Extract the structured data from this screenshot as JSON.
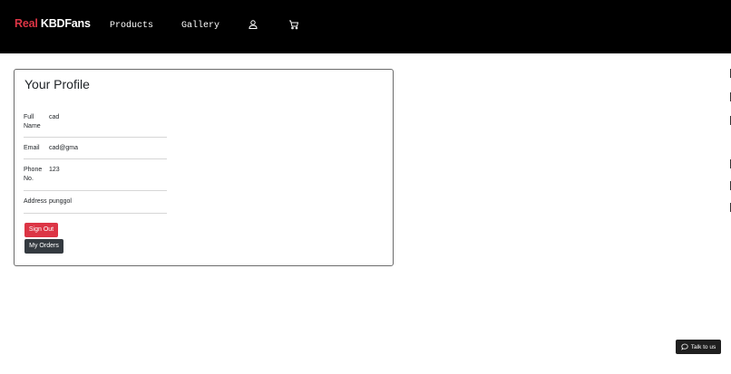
{
  "navbar": {
    "brand_prefix": "Real",
    "brand_name": "KBDFans",
    "links": [
      {
        "label": "Products"
      },
      {
        "label": "Gallery"
      }
    ],
    "icons": [
      "user-icon",
      "cart-icon"
    ]
  },
  "profile": {
    "title": "Your Profile",
    "rows": [
      {
        "label": "Full Name",
        "value": "cad"
      },
      {
        "label": "Email",
        "value": "cad@gma"
      },
      {
        "label": "Phone No.",
        "value": "123"
      },
      {
        "label": "Address",
        "value": "punggol"
      }
    ],
    "sign_out_label": "Sign Out",
    "my_orders_label": "My Orders"
  },
  "chat": {
    "label": "Talk to us",
    "icon": "chat-bubble-icon"
  },
  "colors": {
    "brand_red": "#dc3545",
    "navbar_bg": "#000000",
    "dark_button": "#343a40"
  }
}
